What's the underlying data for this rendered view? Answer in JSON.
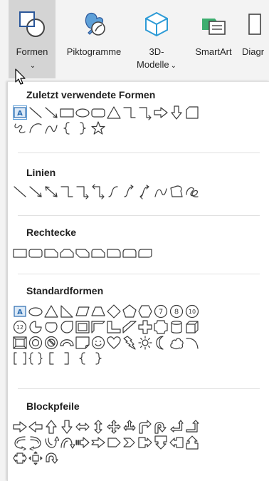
{
  "ribbon": {
    "buttons": [
      {
        "id": "formen",
        "label": "Formen",
        "has_dropdown": true,
        "active": true
      },
      {
        "id": "piktogramme",
        "label": "Piktogramme",
        "has_dropdown": false
      },
      {
        "id": "modelle3d",
        "label_line1": "3D-",
        "label_line2": "Modelle",
        "has_dropdown": true
      },
      {
        "id": "smartart",
        "label": "SmartArt",
        "has_dropdown": false
      },
      {
        "id": "diagramm",
        "label": "Diagr",
        "has_dropdown": false
      }
    ],
    "chevron": "⌄"
  },
  "panel": {
    "sections": [
      {
        "title": "Zuletzt verwendete Formen",
        "rows": [
          [
            "textbox",
            "line",
            "line-arrow",
            "rect",
            "ellipse",
            "rounded-rect",
            "triangle",
            "elbow",
            "elbow-arrow",
            "right-arrow",
            "down-arrow",
            "flowchart-card"
          ],
          [
            "freeform",
            "arc-curve",
            "curve",
            "left-brace",
            "right-brace",
            "star"
          ]
        ]
      },
      {
        "title": "Linien",
        "rows": [
          [
            "line",
            "line-arrow",
            "double-arrow-line",
            "elbow",
            "elbow-arrow",
            "elbow-double-arrow",
            "curved-connector",
            "curved-connector-arrow",
            "curved-connector-double",
            "curve",
            "freeform-closed",
            "scribble"
          ]
        ]
      },
      {
        "title": "Rechtecke",
        "rows": [
          [
            "rect",
            "rounded-rect",
            "snip-one",
            "snip-two",
            "snip-diagonal",
            "round-snip",
            "round-one",
            "round-two",
            "round-diagonal"
          ]
        ]
      },
      {
        "title": "Standardformen",
        "rows": [
          [
            "textbox",
            "ellipse",
            "triangle",
            "right-triangle",
            "parallelogram",
            "trapezoid",
            "diamond",
            "pentagon",
            "hexagon",
            "heptagon",
            "octagon",
            "decagon"
          ],
          [
            "dodecagon",
            "pie",
            "chord",
            "teardrop",
            "frame",
            "half-frame",
            "l-shape",
            "diagonal-stripe",
            "cross",
            "plaque",
            "can",
            "cube"
          ],
          [
            "bevel",
            "donut",
            "no-symbol",
            "block-arc",
            "folded-corner",
            "smiley",
            "heart",
            "lightning",
            "sun",
            "moon",
            "cloud",
            "arc"
          ],
          [
            "bracket-pair",
            "brace-pair",
            "left-bracket",
            "right-bracket",
            "left-brace",
            "right-brace"
          ]
        ]
      },
      {
        "title": "Blockpfeile",
        "rows": [
          [
            "right-arrow",
            "left-arrow",
            "up-arrow",
            "down-arrow",
            "left-right-arrow",
            "up-down-arrow",
            "quad-arrow",
            "left-right-up-arrow",
            "bent-arrow",
            "u-turn-arrow",
            "left-up-arrow",
            "bent-up-arrow"
          ],
          [
            "curved-right-arrow",
            "curved-left-arrow",
            "curved-up-arrow",
            "curved-down-arrow",
            "striped-right-arrow",
            "notched-right-arrow",
            "pentagon-arrow",
            "chevron",
            "right-arrow-callout",
            "down-arrow-callout",
            "left-arrow-callout",
            "up-arrow-callout"
          ],
          [
            "left-right-arrow-callout",
            "quad-arrow-callout",
            "circular-arrow"
          ]
        ]
      }
    ]
  }
}
